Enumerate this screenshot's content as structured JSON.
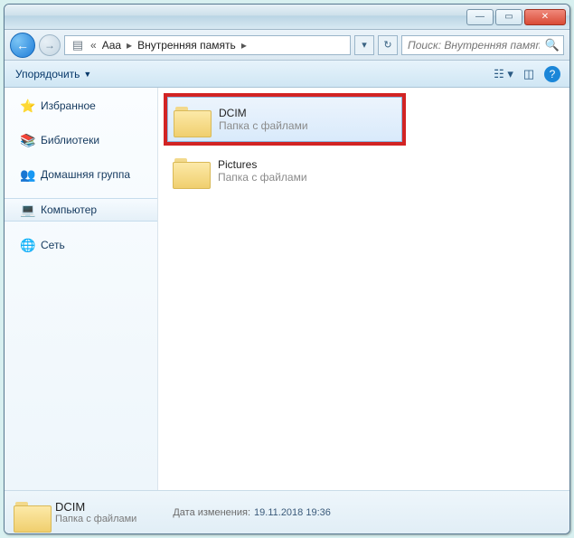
{
  "titlebar": {},
  "nav": {
    "breadcrumb": [
      "Aaa",
      "Внутренняя память"
    ]
  },
  "search": {
    "placeholder": "Поиск: Внутренняя память"
  },
  "toolbar": {
    "organize": "Упорядочить"
  },
  "sidebar": {
    "items": [
      {
        "label": "Избранное",
        "icon": "star"
      },
      {
        "label": "Библиотеки",
        "icon": "library"
      },
      {
        "label": "Домашняя группа",
        "icon": "homegroup"
      },
      {
        "label": "Компьютер",
        "icon": "computer"
      },
      {
        "label": "Сеть",
        "icon": "network"
      }
    ]
  },
  "content": {
    "folders": [
      {
        "name": "DCIM",
        "subtitle": "Папка с файлами",
        "selected": true
      },
      {
        "name": "Pictures",
        "subtitle": "Папка с файлами",
        "selected": false
      }
    ]
  },
  "details": {
    "name": "DCIM",
    "subtitle": "Папка с файлами",
    "date_label": "Дата изменения:",
    "date_value": "19.11.2018 19:36"
  }
}
